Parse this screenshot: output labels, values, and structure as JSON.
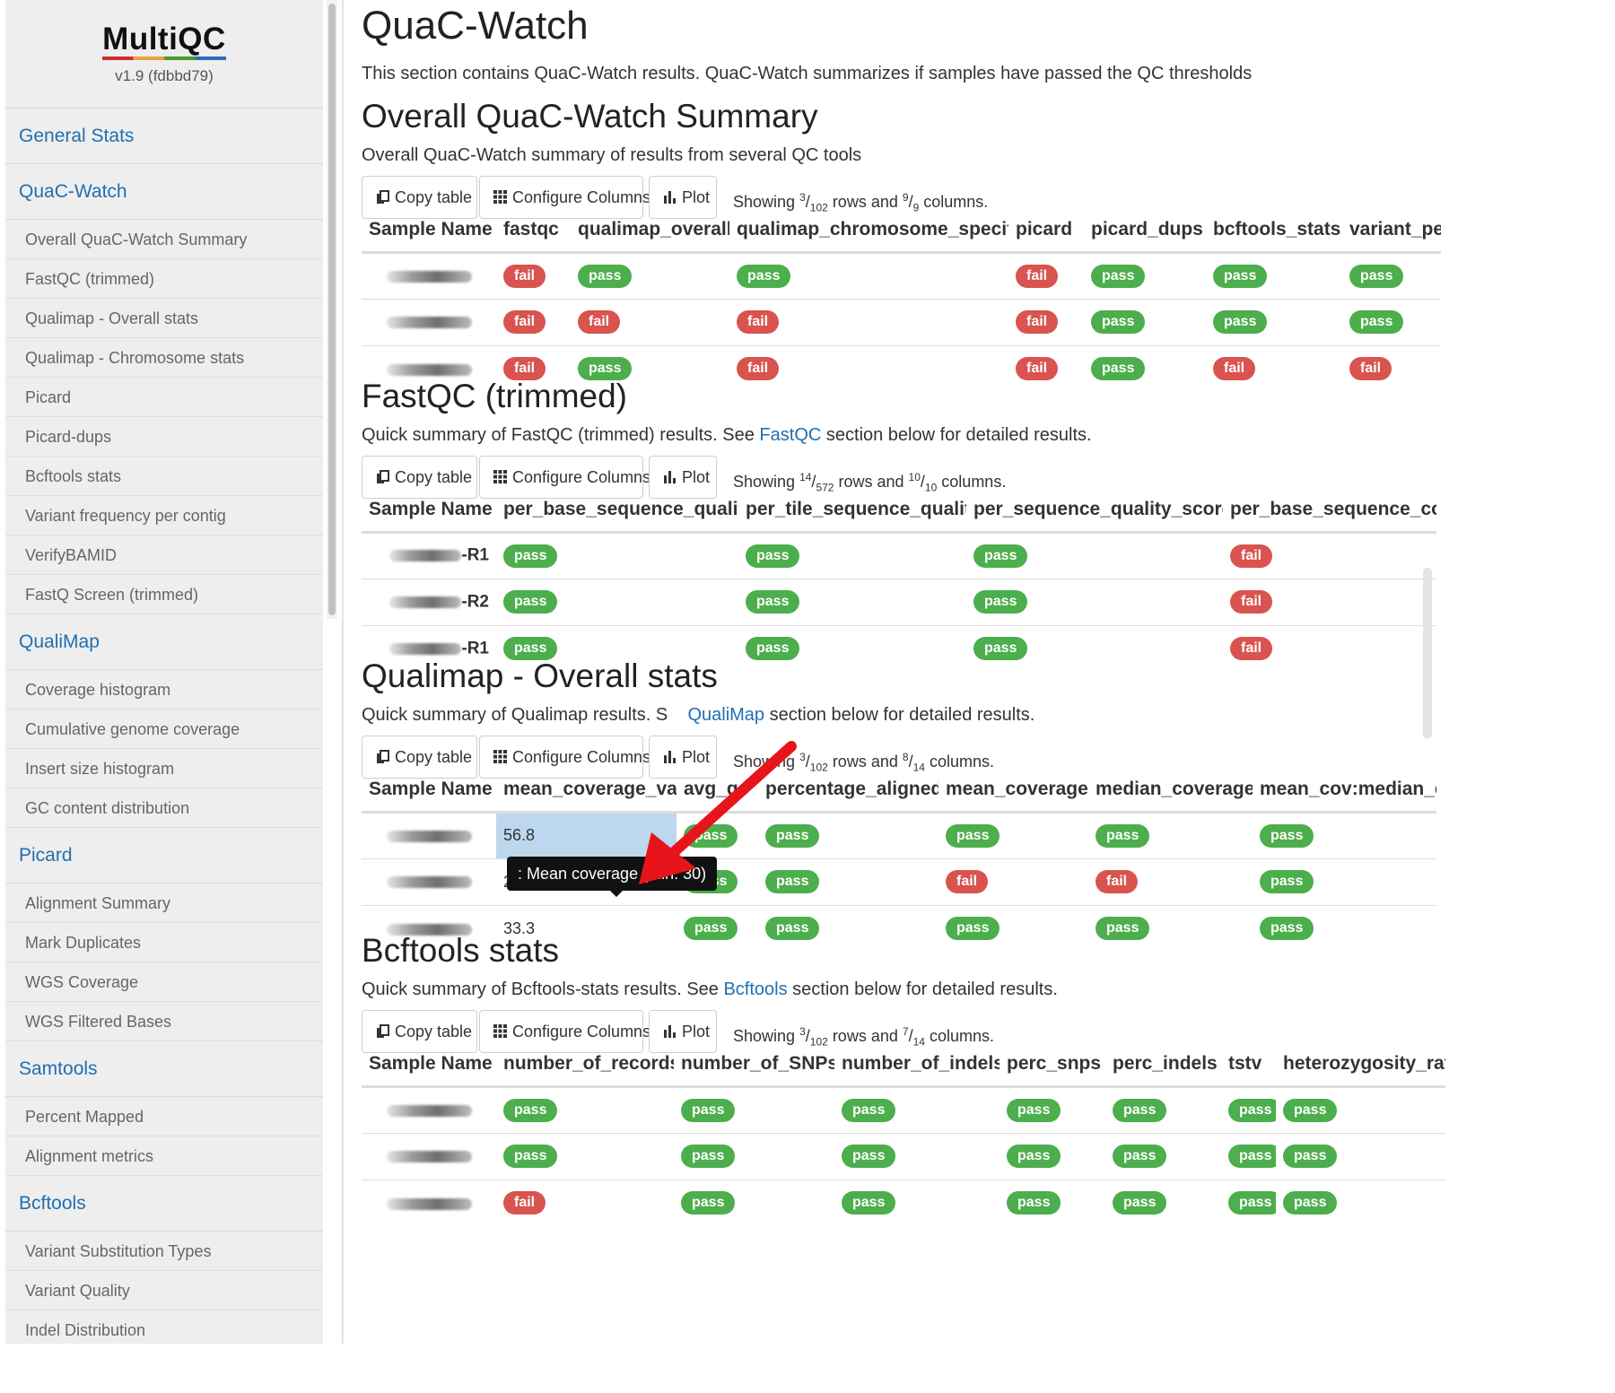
{
  "sidebar": {
    "logo": "MultiQC",
    "version": "v1.9 (fdbbd79)",
    "items": [
      {
        "label": "General Stats",
        "type": "section"
      },
      {
        "label": "QuaC-Watch",
        "type": "section"
      },
      {
        "label": "Overall QuaC-Watch Summary",
        "type": "sub"
      },
      {
        "label": "FastQC (trimmed)",
        "type": "sub"
      },
      {
        "label": "Qualimap - Overall stats",
        "type": "sub"
      },
      {
        "label": "Qualimap - Chromosome stats",
        "type": "sub"
      },
      {
        "label": "Picard",
        "type": "sub"
      },
      {
        "label": "Picard-dups",
        "type": "sub"
      },
      {
        "label": "Bcftools stats",
        "type": "sub"
      },
      {
        "label": "Variant frequency per contig",
        "type": "sub"
      },
      {
        "label": "VerifyBAMID",
        "type": "sub"
      },
      {
        "label": "FastQ Screen (trimmed)",
        "type": "sub"
      },
      {
        "label": "QualiMap",
        "type": "section"
      },
      {
        "label": "Coverage histogram",
        "type": "sub"
      },
      {
        "label": "Cumulative genome coverage",
        "type": "sub"
      },
      {
        "label": "Insert size histogram",
        "type": "sub"
      },
      {
        "label": "GC content distribution",
        "type": "sub"
      },
      {
        "label": "Picard",
        "type": "section"
      },
      {
        "label": "Alignment Summary",
        "type": "sub"
      },
      {
        "label": "Mark Duplicates",
        "type": "sub"
      },
      {
        "label": "WGS Coverage",
        "type": "sub"
      },
      {
        "label": "WGS Filtered Bases",
        "type": "sub"
      },
      {
        "label": "Samtools",
        "type": "section"
      },
      {
        "label": "Percent Mapped",
        "type": "sub"
      },
      {
        "label": "Alignment metrics",
        "type": "sub"
      },
      {
        "label": "Bcftools",
        "type": "section"
      },
      {
        "label": "Variant Substitution Types",
        "type": "sub"
      },
      {
        "label": "Variant Quality",
        "type": "sub"
      },
      {
        "label": "Indel Distribution",
        "type": "sub"
      }
    ]
  },
  "page": {
    "title": "QuaC-Watch",
    "description": "This section contains QuaC-Watch results. QuaC-Watch summarizes if samples have passed the QC thresholds"
  },
  "toolbar": {
    "copy_label": "Copy table",
    "configure_label": "Configure Columns",
    "plot_label": "Plot",
    "showing_prefix": "Showing",
    "rows_word": "rows and",
    "columns_word": "columns."
  },
  "sections": [
    {
      "title": "Overall QuaC-Watch Summary",
      "desc": "Overall QuaC-Watch summary of results from several QC tools",
      "showing": {
        "rows_num": "3",
        "rows_den": "102",
        "cols_num": "9",
        "cols_den": "9"
      },
      "columns": [
        "Sample Name",
        "fastqc",
        "qualimap_overall",
        "qualimap_chromosome_specific",
        "picard",
        "picard_dups",
        "bcftools_stats",
        "variant_per_c"
      ],
      "rows": [
        {
          "suffix": "",
          "cells": [
            "fail",
            "pass",
            "pass",
            "fail",
            "pass",
            "pass",
            "pass"
          ]
        },
        {
          "suffix": "",
          "cells": [
            "fail",
            "fail",
            "fail",
            "fail",
            "pass",
            "pass",
            "pass"
          ]
        },
        {
          "suffix": "",
          "cells": [
            "fail",
            "pass",
            "fail",
            "fail",
            "pass",
            "fail",
            "fail"
          ]
        }
      ]
    },
    {
      "title": "FastQC (trimmed)",
      "desc_pre": "Quick summary of FastQC (trimmed) results. See ",
      "desc_link": "FastQC",
      "desc_post": " section below for detailed results.",
      "showing": {
        "rows_num": "14",
        "rows_den": "572",
        "cols_num": "10",
        "cols_den": "10"
      },
      "columns": [
        "Sample Name",
        "per_base_sequence_quality",
        "per_tile_sequence_quality",
        "per_sequence_quality_scores",
        "per_base_sequence_cont"
      ],
      "rows": [
        {
          "suffix": "-R1",
          "cells": [
            "pass",
            "pass",
            "pass",
            "fail"
          ]
        },
        {
          "suffix": "-R2",
          "cells": [
            "pass",
            "pass",
            "pass",
            "fail"
          ]
        },
        {
          "suffix": "-R1",
          "cells": [
            "pass",
            "pass",
            "pass",
            "fail"
          ]
        }
      ]
    },
    {
      "title": "Qualimap - Overall stats",
      "desc_pre": "Quick summary of Qualimap results. S",
      "desc_link": "QualiMap",
      "desc_post": " section below for detailed results.",
      "showing": {
        "rows_num": "3",
        "rows_den": "102",
        "cols_num": "8",
        "cols_den": "14"
      },
      "columns": [
        "Sample Name",
        "mean_coverage_val",
        "avg_gc",
        "percentage_aligned",
        "mean_coverage",
        "median_coverage",
        "mean_cov:median_cov"
      ],
      "rows": [
        {
          "suffix": "",
          "cells": [
            "56.8",
            "pass",
            "pass",
            "pass",
            "pass",
            "pass"
          ]
        },
        {
          "suffix": "",
          "cells": [
            "26.7",
            "pass",
            "pass",
            "fail",
            "fail",
            "pass"
          ]
        },
        {
          "suffix": "",
          "cells": [
            "33.3",
            "pass",
            "pass",
            "pass",
            "pass",
            "pass"
          ]
        }
      ],
      "tooltip": ": Mean coverage (min: 30)"
    },
    {
      "title": "Bcftools stats",
      "desc_pre": "Quick summary of Bcftools-stats results. See ",
      "desc_link": "Bcftools",
      "desc_post": " section below for detailed results.",
      "showing": {
        "rows_num": "3",
        "rows_den": "102",
        "cols_num": "7",
        "cols_den": "14"
      },
      "columns": [
        "Sample Name",
        "number_of_records",
        "number_of_SNPs",
        "number_of_indels",
        "perc_snps",
        "perc_indels",
        "tstv",
        "heterozygosity_ratio"
      ],
      "rows": [
        {
          "suffix": "",
          "cells": [
            "pass",
            "pass",
            "pass",
            "pass",
            "pass",
            "pass",
            "pass"
          ]
        },
        {
          "suffix": "",
          "cells": [
            "pass",
            "pass",
            "pass",
            "pass",
            "pass",
            "pass",
            "pass"
          ]
        },
        {
          "suffix": "",
          "cells": [
            "fail",
            "pass",
            "pass",
            "pass",
            "pass",
            "pass",
            "pass"
          ]
        }
      ]
    }
  ],
  "colors": {
    "pass": "#4cae4c",
    "fail": "#d9534f",
    "link": "#1f6fb2",
    "highlight": "#bdd7ee"
  }
}
